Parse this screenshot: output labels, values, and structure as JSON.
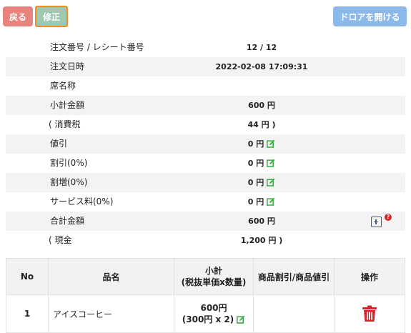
{
  "toolbar": {
    "back_label": "戻る",
    "fix_label": "修正",
    "drawer_label": "ドロアを開ける"
  },
  "info": {
    "order_label": "注文番号 / レシート番号",
    "order_value": "12 / 12",
    "datetime_label": "注文日時",
    "datetime_value": "2022-02-08 17:09:31",
    "seat_label": "席名称",
    "seat_value": "",
    "subtotal_label": "小計金額",
    "subtotal_value": "600 円",
    "tax_label": "( 消費税",
    "tax_value": "44 円 )",
    "discount_label": "値引",
    "discount_value": "0 円",
    "discount_pct_label": "割引(0%)",
    "discount_pct_value": "0 円",
    "surcharge_label": "割増(0%)",
    "surcharge_value": "0 円",
    "service_label": "サービス料(0%)",
    "service_value": "0 円",
    "total_label": "合計金額",
    "total_value": "600 円",
    "cash_label": "( 現金",
    "cash_value": "1,200 円 )",
    "help_mark": "?"
  },
  "table": {
    "headers": {
      "no": "No",
      "name": "品名",
      "subtotal_line1": "小計",
      "subtotal_line2": "(税抜単価x数量)",
      "discount": "商品割引/商品値引",
      "action": "操作"
    },
    "rows": [
      {
        "no": "1",
        "name": "アイスコーヒー",
        "subtotal": "600円",
        "detail": "(300円 x 2)"
      }
    ]
  },
  "colors": {
    "back": "#e8837e",
    "fix": "#9dc9b1",
    "drawer": "#8db8ea",
    "edit_icon": "#3fae49",
    "trash_icon": "#d9252a"
  }
}
